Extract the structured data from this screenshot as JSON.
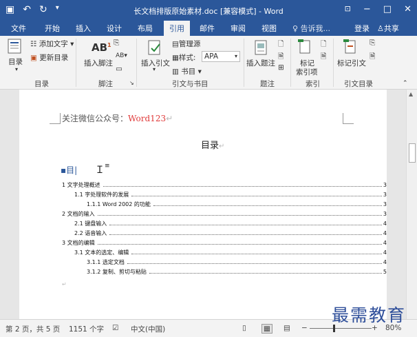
{
  "titlebar": {
    "title": "长文档排版原始素材.doc [兼容模式] - Word",
    "qat_icons": [
      "save-icon",
      "undo-icon",
      "redo-icon",
      "customize-icon"
    ],
    "win_icons": [
      "ribbon-display-icon",
      "minimize-icon",
      "maximize-icon",
      "close-icon"
    ]
  },
  "tabs": {
    "items": [
      "文件",
      "开始",
      "插入",
      "设计",
      "布局",
      "引用",
      "邮件",
      "审阅",
      "视图"
    ],
    "active": "引用",
    "tell_me": "告诉我...",
    "login": "登录",
    "share": "共享"
  },
  "ribbon": {
    "toc": {
      "label": "目录",
      "add_text": "添加文字",
      "update_toc": "更新目录",
      "group": "目录"
    },
    "footnote": {
      "insert_footnote": "插入脚注",
      "group": "脚注"
    },
    "citations": {
      "insert_citation": "插入引文",
      "manage_sources": "管理源",
      "style_label": "样式:",
      "style_value": "APA",
      "bibliography": "书目",
      "group": "引文与书目"
    },
    "captions": {
      "insert_caption": "插入题注",
      "group": "题注"
    },
    "index": {
      "mark_entry_1": "标记",
      "mark_entry_2": "索引项",
      "group": "索引"
    },
    "toa": {
      "mark_citation": "标记引文",
      "group": "引文目录"
    }
  },
  "document": {
    "header_text": "关注微信公众号：",
    "header_red": "Word123",
    "toc_title": "目录",
    "toc_field": "目",
    "toc_entries": [
      {
        "level": 1,
        "text": "1 文字处理概述",
        "page": "3"
      },
      {
        "level": 2,
        "text": "1.1  字处理软件的发展",
        "page": "3"
      },
      {
        "level": 3,
        "text": "1.1.1 Word 2002 的功能",
        "page": "3"
      },
      {
        "level": 1,
        "text": "2 文档的输入",
        "page": "3"
      },
      {
        "level": 2,
        "text": "2.1 键盘输入",
        "page": "4"
      },
      {
        "level": 2,
        "text": "2.2 语音输入",
        "page": "4"
      },
      {
        "level": 1,
        "text": "3 文档的编辑",
        "page": "4"
      },
      {
        "level": 2,
        "text": "3.1  文本的选定、编辑",
        "page": "4"
      },
      {
        "level": 3,
        "text": "3.1.1 选定文档",
        "page": "4"
      },
      {
        "level": 3,
        "text": "3.1.2 复制、剪切与粘贴",
        "page": "5"
      }
    ]
  },
  "status": {
    "page_info": "第 2 页，共 5 页",
    "word_count": "1151 个字",
    "language": "中文(中国)",
    "zoom": "80%"
  },
  "watermark": "最需教育",
  "colors": {
    "brand": "#2b579a",
    "header_red": "#e03a3a"
  }
}
